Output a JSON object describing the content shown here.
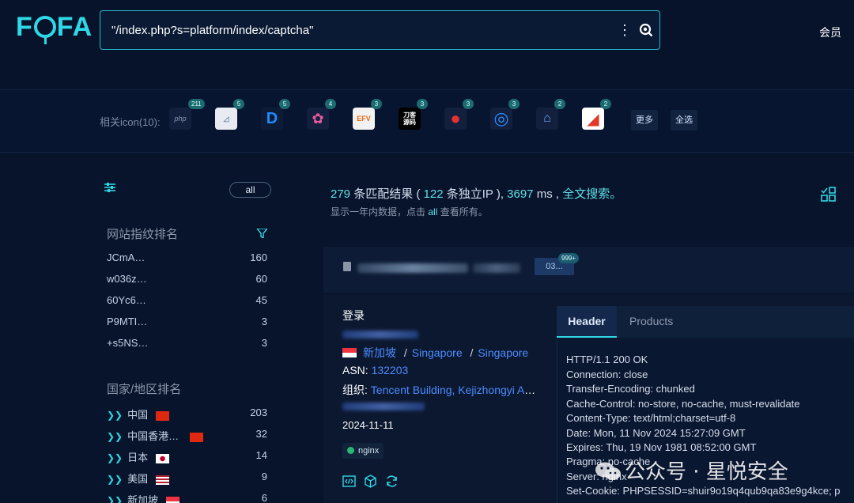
{
  "header": {
    "logo": "FOFA",
    "query": "\"/index.php?s=platform/index/captcha\"",
    "member": "会员"
  },
  "icons": {
    "label": "相关icon(10):",
    "items": [
      {
        "glyph": "php",
        "count": "211"
      },
      {
        "glyph": "◿",
        "count": "5"
      },
      {
        "glyph": "D",
        "count": "5"
      },
      {
        "glyph": "✿",
        "count": "4"
      },
      {
        "glyph": "EFV",
        "count": "3"
      },
      {
        "glyph": "刀客\n源码",
        "count": "3"
      },
      {
        "glyph": "●",
        "count": "3"
      },
      {
        "glyph": "◎",
        "count": "3"
      },
      {
        "glyph": "⌂",
        "count": "2"
      },
      {
        "glyph": "◢",
        "count": "2"
      }
    ],
    "more": "更多",
    "select_all": "全选"
  },
  "sidebar": {
    "all": "all",
    "fp_title": "网站指纹排名",
    "fingerprints": [
      {
        "name": "JCmA…",
        "count": "160"
      },
      {
        "name": "w036z…",
        "count": "60"
      },
      {
        "name": "60Yc6…",
        "count": "45"
      },
      {
        "name": "P9MTI…",
        "count": "3"
      },
      {
        "name": "+s5NS…",
        "count": "3"
      }
    ],
    "country_title": "国家/地区排名",
    "countries": [
      {
        "name": "中国",
        "count": "203"
      },
      {
        "name": "中国香港…",
        "count": "32"
      },
      {
        "name": "日本",
        "count": "14"
      },
      {
        "name": "美国",
        "count": "9"
      },
      {
        "name": "新加坡",
        "count": "6"
      }
    ]
  },
  "summary": {
    "results": "279",
    "results_label": "条匹配结果 (",
    "ips": "122",
    "ips_label": "条独立IP ),",
    "ms": "3697",
    "ms_label": "ms ,",
    "fulltext": "全文搜索。",
    "sub_a": "显示一年内数据，点击",
    "sub_all": "all",
    "sub_b": "查看所有。"
  },
  "result": {
    "badge": "999+",
    "title": "登录",
    "country": "新加坡",
    "city1": "Singapore",
    "city2": "Singapore",
    "asn_label": "ASN:",
    "asn": "132203",
    "org_label": "组织:",
    "org": "Tencent Building, Kejizhongyi Av…",
    "date": "2024-11-11",
    "server_tag": "nginx",
    "tabs": {
      "header": "Header",
      "products": "Products"
    },
    "headers": [
      "HTTP/1.1 200 OK",
      "Connection: close",
      "Transfer-Encoding: chunked",
      "Cache-Control: no-store, no-cache, must-revalidate",
      "Content-Type: text/html;charset=utf-8",
      "Date: Mon, 11 Nov 2024 15:27:09 GMT",
      "Expires: Thu, 19 Nov 1981 08:52:00 GMT",
      "Pragma: no-cache",
      "Server: nginx",
      "Set-Cookie: PHPSESSID=shuir9o19q4qub9qa83e9g4kce; p"
    ]
  },
  "watermark": "公众号 · 星悦安全"
}
